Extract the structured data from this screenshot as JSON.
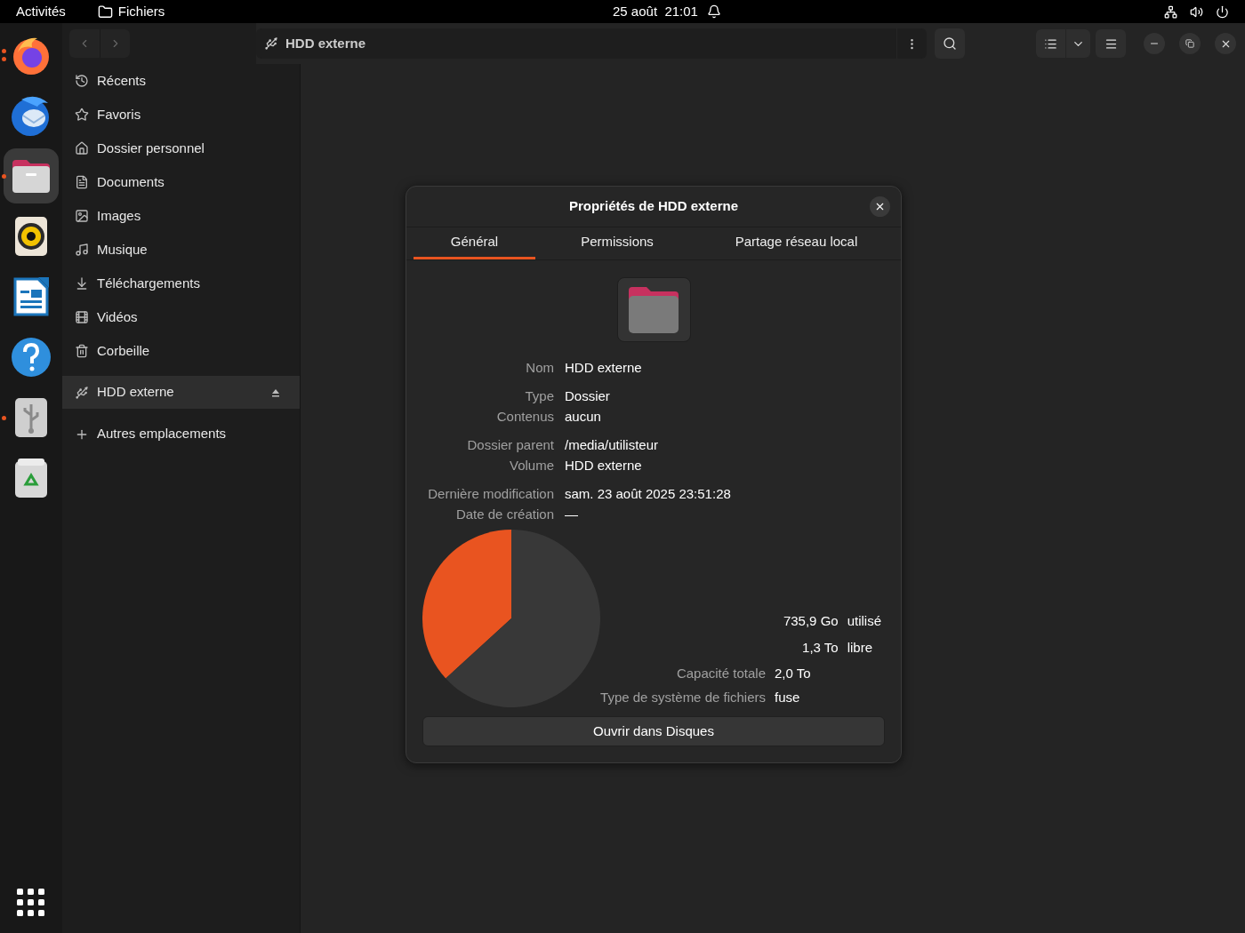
{
  "top_bar": {
    "activities": "Activités",
    "app_name": "Fichiers",
    "date": "25 août",
    "time": "21:01"
  },
  "dock": {
    "items": [
      {
        "kind": "firefox",
        "running": true,
        "multiple_windows": true,
        "selected": false
      },
      {
        "kind": "thunderbird",
        "running": false,
        "multiple_windows": false,
        "selected": false
      },
      {
        "kind": "files",
        "running": true,
        "multiple_windows": false,
        "selected": true
      },
      {
        "kind": "rhythmbox",
        "running": false,
        "multiple_windows": false,
        "selected": false
      },
      {
        "kind": "writer",
        "running": false,
        "multiple_windows": false,
        "selected": false
      },
      {
        "kind": "help",
        "running": false,
        "multiple_windows": false,
        "selected": false
      },
      {
        "kind": "usb",
        "running": true,
        "multiple_windows": false,
        "selected": false
      },
      {
        "kind": "trash",
        "running": false,
        "multiple_windows": false,
        "selected": false
      }
    ]
  },
  "path_bar": {
    "location": "HDD externe"
  },
  "sidebar": {
    "items": [
      {
        "label": "Récents",
        "selected": false
      },
      {
        "label": "Favoris",
        "selected": false
      },
      {
        "label": "Dossier personnel",
        "selected": false
      },
      {
        "label": "Documents",
        "selected": false
      },
      {
        "label": "Images",
        "selected": false
      },
      {
        "label": "Musique",
        "selected": false
      },
      {
        "label": "Téléchargements",
        "selected": false
      },
      {
        "label": "Vidéos",
        "selected": false
      },
      {
        "label": "Corbeille",
        "selected": false
      }
    ],
    "devices": [
      {
        "label": "HDD externe",
        "selected": true
      }
    ],
    "other": {
      "label": "Autres emplacements"
    }
  },
  "dialog": {
    "title": "Propriétés de HDD externe",
    "tabs": [
      {
        "label": "Général",
        "selected": true
      },
      {
        "label": "Permissions",
        "selected": false
      },
      {
        "label": "Partage réseau local",
        "selected": false
      }
    ],
    "groups": [
      [
        {
          "label": "Nom",
          "value": "HDD externe"
        }
      ],
      [
        {
          "label": "Type",
          "value": "Dossier"
        },
        {
          "label": "Contenus",
          "value": "aucun"
        }
      ],
      [
        {
          "label": "Dossier parent",
          "value": "/media/utilisteur"
        },
        {
          "label": "Volume",
          "value": "HDD externe"
        }
      ],
      [
        {
          "label": "Dernière modification",
          "value": "sam. 23 août 2025 23:51:28"
        },
        {
          "label": "Date de création",
          "value": "—"
        }
      ]
    ],
    "usage": {
      "chart_data": {
        "type": "pie",
        "categories": [
          "utilisé",
          "libre"
        ],
        "values": [
          36.8,
          63.2
        ]
      },
      "used": {
        "amount": "735,9 Go"
      },
      "free": {
        "amount": "1,3 To"
      },
      "rows": [
        {
          "label": "Capacité totale",
          "value": "2,0 To"
        },
        {
          "label": "Type de système de fichiers",
          "value": "fuse"
        }
      ]
    },
    "button": "Ouvrir dans Disques"
  }
}
